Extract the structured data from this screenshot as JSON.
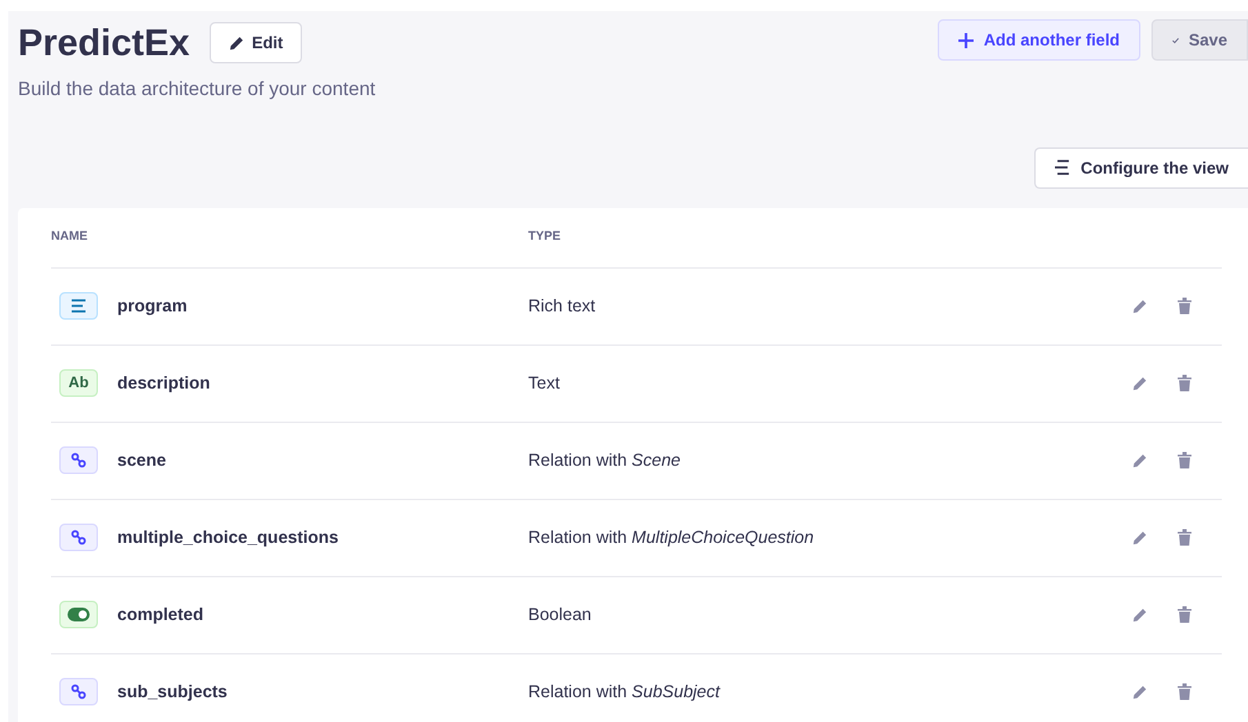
{
  "header": {
    "title": "PredictEx",
    "edit_button": "Edit",
    "subtitle": "Build the data architecture of your content",
    "add_button": "Add another field",
    "save_button": {
      "label": "Save",
      "disabled": true
    }
  },
  "configure_button": "Configure the view",
  "table": {
    "columns": [
      "NAME",
      "TYPE"
    ],
    "rows": [
      {
        "kind": "richtext",
        "name": "program",
        "type": "Rich text"
      },
      {
        "kind": "text",
        "name": "description",
        "type": "Text",
        "icon_text": "Ab"
      },
      {
        "kind": "relation",
        "name": "scene",
        "type": "Relation with *Scene*"
      },
      {
        "kind": "relation",
        "name": "multiple_choice_questions",
        "type": "Relation with *MultipleChoiceQuestion*"
      },
      {
        "kind": "boolean",
        "name": "completed",
        "type": "Boolean"
      },
      {
        "kind": "relation",
        "name": "sub_subjects",
        "type": "Relation with *SubSubject*"
      }
    ]
  }
}
